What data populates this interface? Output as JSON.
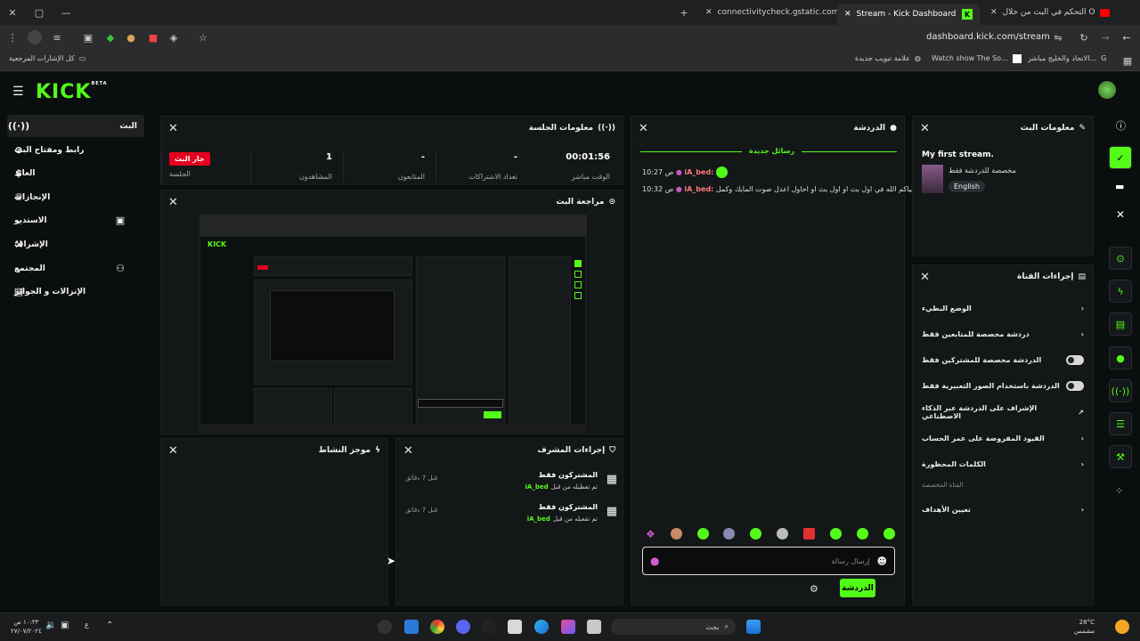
{
  "browser": {
    "tabs": [
      {
        "label": "connectivitycheck.gstatic.com"
      },
      {
        "label": "Stream - Kick Dashboard"
      },
      {
        "label": "التحكم في البث من خلال OBS ..."
      }
    ],
    "url": "dashboard.kick.com/stream",
    "bookmarks": [
      {
        "label": "كل الإشارات المرجعية"
      },
      {
        "label": "علامة تبويب جديدة"
      },
      {
        "label": "Watch show The So..."
      },
      {
        "label": "الاتحاد والخليج مباشر..."
      }
    ]
  },
  "brand": {
    "name": "KICK",
    "badge": "BETA",
    "color": "#53fc18"
  },
  "sidebar": {
    "items": [
      {
        "label": "البث",
        "icon": "broadcast-icon"
      },
      {
        "label": "رابط ومفتاح البث",
        "icon": "link-icon"
      },
      {
        "label": "العائد",
        "icon": "dollar-icon"
      },
      {
        "label": "الإنجازات",
        "icon": "trophy-icon"
      },
      {
        "label": "الاستديو",
        "icon": "studio-icon"
      },
      {
        "label": "الإشراف",
        "icon": "hammer-icon"
      },
      {
        "label": "المجتمع",
        "icon": "community-icon"
      },
      {
        "label": "الإنزالات و الجوائز",
        "icon": "gift-icon"
      }
    ]
  },
  "session": {
    "title": "معلومات الجلسة",
    "live_badge": "جار البث",
    "stats": [
      {
        "label": "الوقت مباشر",
        "value": "00:01:56"
      },
      {
        "label": "تعداد الاشتراكات",
        "value": "-"
      },
      {
        "label": "المتابعون",
        "value": "-"
      },
      {
        "label": "المشاهدون",
        "value": "1"
      },
      {
        "label": "الجلسة",
        "value": ""
      }
    ]
  },
  "preview": {
    "title": "مراجعة البث"
  },
  "activity": {
    "title": "موجز النشاط"
  },
  "mod_actions": {
    "title": "إجراءات المشرف",
    "items": [
      {
        "title": "المشتركون فقط",
        "user": "iA_bed",
        "desc": "تم تعطيله من قبل",
        "time": "قبل 7 دقائق"
      },
      {
        "title": "المشتركون فقط",
        "user": "iA_bed",
        "desc": "تم تفعيله من قبل",
        "time": "قبل 7 دقائق"
      }
    ]
  },
  "chat": {
    "title": "الدردشة",
    "new_messages": "رسائل جديدة",
    "messages": [
      {
        "time": "10:27 ص",
        "user": "iA_bed:",
        "text": ""
      },
      {
        "time": "10:32 ص",
        "user": "iA_bed:",
        "text": "حياكم الله في اول بث او اول بث او احاول اعدل صوت المايك وكمل"
      }
    ],
    "placeholder": "إرسال رسالة",
    "send_label": "الدردشة"
  },
  "stream_info": {
    "title": "معلومات البث",
    "stream_title": "My first stream.",
    "category": "مخصصة للدردشة فقط",
    "language": "English"
  },
  "channel_actions": {
    "title": "إجراءات القناة",
    "rows": [
      {
        "label": "الوضع البطيء",
        "control": "chevron"
      },
      {
        "label": "دردشة مخصصة للمتابعين فقط",
        "control": "chevron"
      },
      {
        "label": "الدردشة مخصصة للمشتركين فقط",
        "control": "toggle"
      },
      {
        "label": "الدردشة باستخدام الصور التعبيرية فقط",
        "control": "toggle"
      },
      {
        "label": "الإشراف على الدردشة عبر الذكاء الاصطناعي",
        "control": "external"
      },
      {
        "label": "القيود المفروضة على عمر الحساب",
        "control": "chevron"
      },
      {
        "label": "الكلمات المحظورة",
        "control": "chevron"
      }
    ],
    "custom_section": "القناة المخصصة",
    "goals": "تعيين الأهداف"
  },
  "taskbar": {
    "weather": "28°C",
    "weather_sub": "مشمس",
    "search": "بحث",
    "clock_time": "١٠:٣٣ ص",
    "clock_date": "٢٧/٠٧/٢٠٢٤",
    "lang": "ع"
  }
}
